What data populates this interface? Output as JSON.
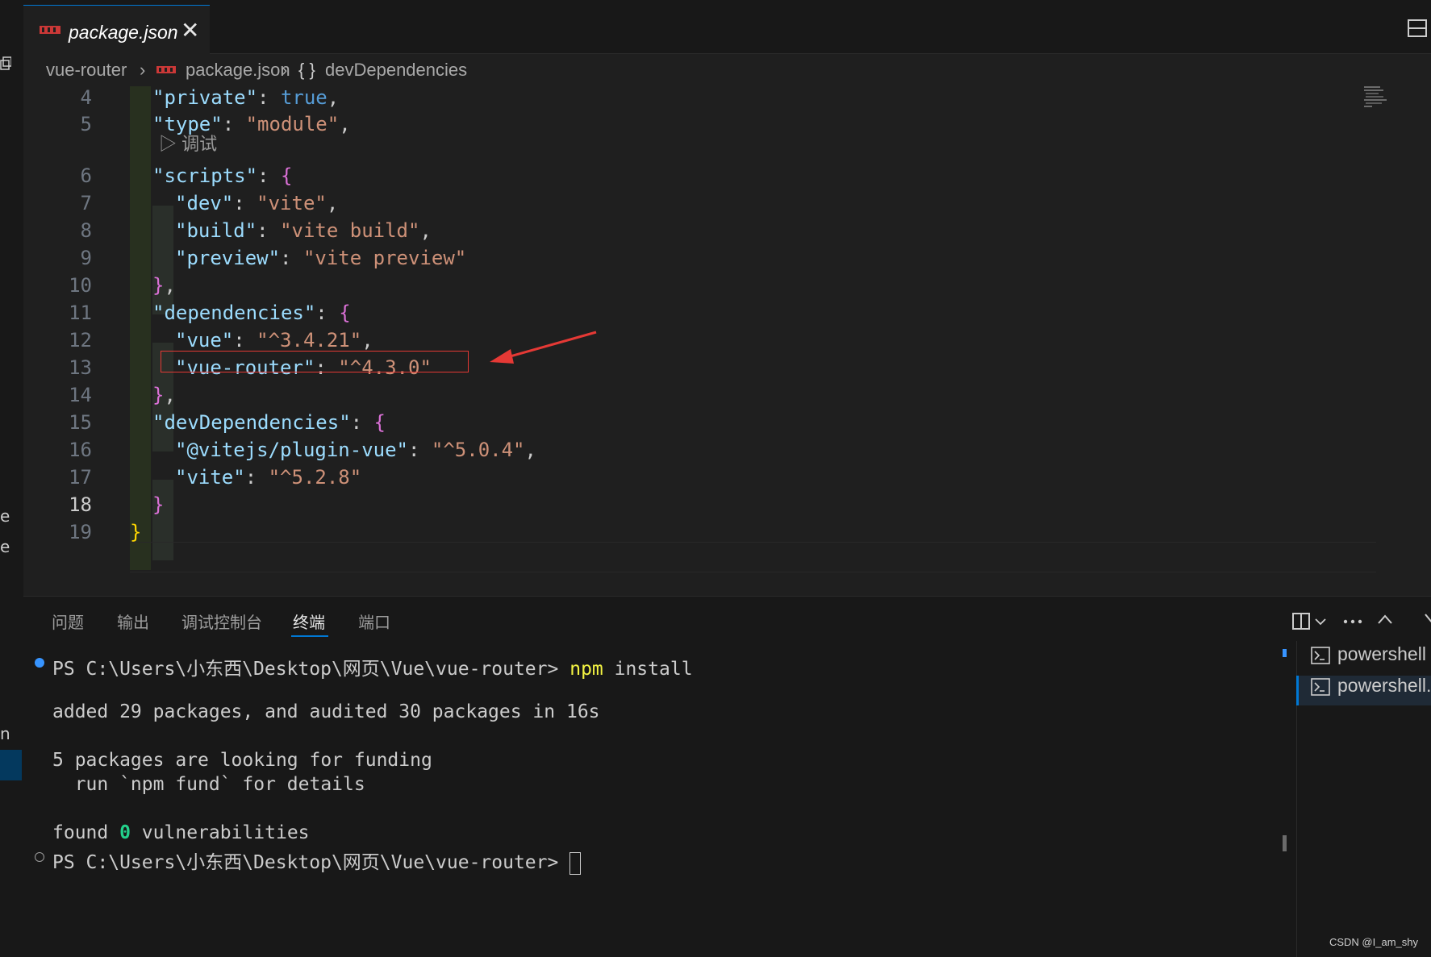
{
  "tab": {
    "label": "package.json",
    "close": "✕"
  },
  "breadcrumb": {
    "folder": "vue-router",
    "file": "package.json",
    "symbol": "devDependencies",
    "symbol_glyph": "{ }",
    "separator": "›"
  },
  "editor": {
    "lines": [
      {
        "num": "4"
      },
      {
        "num": "5"
      },
      {
        "num": "6"
      },
      {
        "num": "7"
      },
      {
        "num": "8"
      },
      {
        "num": "9"
      },
      {
        "num": "10"
      },
      {
        "num": "11"
      },
      {
        "num": "12"
      },
      {
        "num": "13"
      },
      {
        "num": "14"
      },
      {
        "num": "15"
      },
      {
        "num": "16"
      },
      {
        "num": "17"
      },
      {
        "num": "18"
      },
      {
        "num": "19"
      }
    ],
    "codelens": "▷ 调试",
    "tokens": {
      "private_key": "\"private\"",
      "true": "true",
      "type_key": "\"type\"",
      "module": "\"module\"",
      "scripts_key": "\"scripts\"",
      "dev_key": "\"dev\"",
      "vite": "\"vite\"",
      "build_key": "\"build\"",
      "vite_build": "\"vite build\"",
      "preview_key": "\"preview\"",
      "vite_preview": "\"vite preview\"",
      "dependencies_key": "\"dependencies\"",
      "vue_key": "\"vue\"",
      "vue_ver": "\"^3.4.21\"",
      "vue_router_key": "\"vue-router\"",
      "vue_router_ver": "\"^4.3.0\"",
      "devdeps_key": "\"devDependencies\"",
      "plugin_key": "\"@vitejs/plugin-vue\"",
      "plugin_ver": "\"^5.0.4\"",
      "vite_key": "\"vite\"",
      "vite_ver": "\"^5.2.8\""
    },
    "annotation_color": "#e53935"
  },
  "panel": {
    "tabs": [
      "问题",
      "输出",
      "调试控制台",
      "终端",
      "端口"
    ],
    "active_tab": "终端",
    "terminal": {
      "prompt": "PS C:\\Users\\小东西\\Desktop\\网页\\Vue\\vue-router>",
      "command_npm": "npm",
      "command_rest": " install",
      "line_added": "added 29 packages, and audited 30 packages in 16s",
      "line_funding": "5 packages are looking for funding",
      "line_run": "  run `npm fund` for details",
      "line_found": "found ",
      "vuln_count": "0",
      "line_vuln": " vulnerabilities"
    },
    "terminals": [
      "powershell",
      "powershell..."
    ]
  },
  "left_strip": {
    "chars": [
      "e",
      "e",
      "n"
    ]
  },
  "watermark": "CSDN @I_am_shy",
  "colors": {
    "accent": "#0078d4",
    "key": "#9cdcfe",
    "string": "#ce9178",
    "bracket_pink": "#da70d6",
    "bracket_gold": "#ffd700",
    "success": "#23d18b",
    "npm_yellow": "#f5f543"
  }
}
